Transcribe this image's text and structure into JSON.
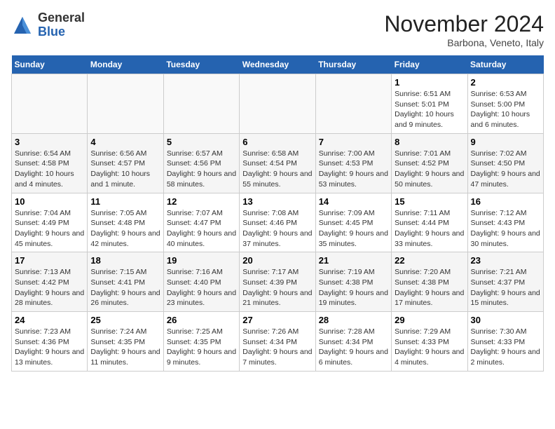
{
  "header": {
    "logo_general": "General",
    "logo_blue": "Blue",
    "month_title": "November 2024",
    "location": "Barbona, Veneto, Italy"
  },
  "weekdays": [
    "Sunday",
    "Monday",
    "Tuesday",
    "Wednesday",
    "Thursday",
    "Friday",
    "Saturday"
  ],
  "weeks": [
    [
      {
        "day": "",
        "info": ""
      },
      {
        "day": "",
        "info": ""
      },
      {
        "day": "",
        "info": ""
      },
      {
        "day": "",
        "info": ""
      },
      {
        "day": "",
        "info": ""
      },
      {
        "day": "1",
        "info": "Sunrise: 6:51 AM\nSunset: 5:01 PM\nDaylight: 10 hours and 9 minutes."
      },
      {
        "day": "2",
        "info": "Sunrise: 6:53 AM\nSunset: 5:00 PM\nDaylight: 10 hours and 6 minutes."
      }
    ],
    [
      {
        "day": "3",
        "info": "Sunrise: 6:54 AM\nSunset: 4:58 PM\nDaylight: 10 hours and 4 minutes."
      },
      {
        "day": "4",
        "info": "Sunrise: 6:56 AM\nSunset: 4:57 PM\nDaylight: 10 hours and 1 minute."
      },
      {
        "day": "5",
        "info": "Sunrise: 6:57 AM\nSunset: 4:56 PM\nDaylight: 9 hours and 58 minutes."
      },
      {
        "day": "6",
        "info": "Sunrise: 6:58 AM\nSunset: 4:54 PM\nDaylight: 9 hours and 55 minutes."
      },
      {
        "day": "7",
        "info": "Sunrise: 7:00 AM\nSunset: 4:53 PM\nDaylight: 9 hours and 53 minutes."
      },
      {
        "day": "8",
        "info": "Sunrise: 7:01 AM\nSunset: 4:52 PM\nDaylight: 9 hours and 50 minutes."
      },
      {
        "day": "9",
        "info": "Sunrise: 7:02 AM\nSunset: 4:50 PM\nDaylight: 9 hours and 47 minutes."
      }
    ],
    [
      {
        "day": "10",
        "info": "Sunrise: 7:04 AM\nSunset: 4:49 PM\nDaylight: 9 hours and 45 minutes."
      },
      {
        "day": "11",
        "info": "Sunrise: 7:05 AM\nSunset: 4:48 PM\nDaylight: 9 hours and 42 minutes."
      },
      {
        "day": "12",
        "info": "Sunrise: 7:07 AM\nSunset: 4:47 PM\nDaylight: 9 hours and 40 minutes."
      },
      {
        "day": "13",
        "info": "Sunrise: 7:08 AM\nSunset: 4:46 PM\nDaylight: 9 hours and 37 minutes."
      },
      {
        "day": "14",
        "info": "Sunrise: 7:09 AM\nSunset: 4:45 PM\nDaylight: 9 hours and 35 minutes."
      },
      {
        "day": "15",
        "info": "Sunrise: 7:11 AM\nSunset: 4:44 PM\nDaylight: 9 hours and 33 minutes."
      },
      {
        "day": "16",
        "info": "Sunrise: 7:12 AM\nSunset: 4:43 PM\nDaylight: 9 hours and 30 minutes."
      }
    ],
    [
      {
        "day": "17",
        "info": "Sunrise: 7:13 AM\nSunset: 4:42 PM\nDaylight: 9 hours and 28 minutes."
      },
      {
        "day": "18",
        "info": "Sunrise: 7:15 AM\nSunset: 4:41 PM\nDaylight: 9 hours and 26 minutes."
      },
      {
        "day": "19",
        "info": "Sunrise: 7:16 AM\nSunset: 4:40 PM\nDaylight: 9 hours and 23 minutes."
      },
      {
        "day": "20",
        "info": "Sunrise: 7:17 AM\nSunset: 4:39 PM\nDaylight: 9 hours and 21 minutes."
      },
      {
        "day": "21",
        "info": "Sunrise: 7:19 AM\nSunset: 4:38 PM\nDaylight: 9 hours and 19 minutes."
      },
      {
        "day": "22",
        "info": "Sunrise: 7:20 AM\nSunset: 4:38 PM\nDaylight: 9 hours and 17 minutes."
      },
      {
        "day": "23",
        "info": "Sunrise: 7:21 AM\nSunset: 4:37 PM\nDaylight: 9 hours and 15 minutes."
      }
    ],
    [
      {
        "day": "24",
        "info": "Sunrise: 7:23 AM\nSunset: 4:36 PM\nDaylight: 9 hours and 13 minutes."
      },
      {
        "day": "25",
        "info": "Sunrise: 7:24 AM\nSunset: 4:35 PM\nDaylight: 9 hours and 11 minutes."
      },
      {
        "day": "26",
        "info": "Sunrise: 7:25 AM\nSunset: 4:35 PM\nDaylight: 9 hours and 9 minutes."
      },
      {
        "day": "27",
        "info": "Sunrise: 7:26 AM\nSunset: 4:34 PM\nDaylight: 9 hours and 7 minutes."
      },
      {
        "day": "28",
        "info": "Sunrise: 7:28 AM\nSunset: 4:34 PM\nDaylight: 9 hours and 6 minutes."
      },
      {
        "day": "29",
        "info": "Sunrise: 7:29 AM\nSunset: 4:33 PM\nDaylight: 9 hours and 4 minutes."
      },
      {
        "day": "30",
        "info": "Sunrise: 7:30 AM\nSunset: 4:33 PM\nDaylight: 9 hours and 2 minutes."
      }
    ]
  ]
}
